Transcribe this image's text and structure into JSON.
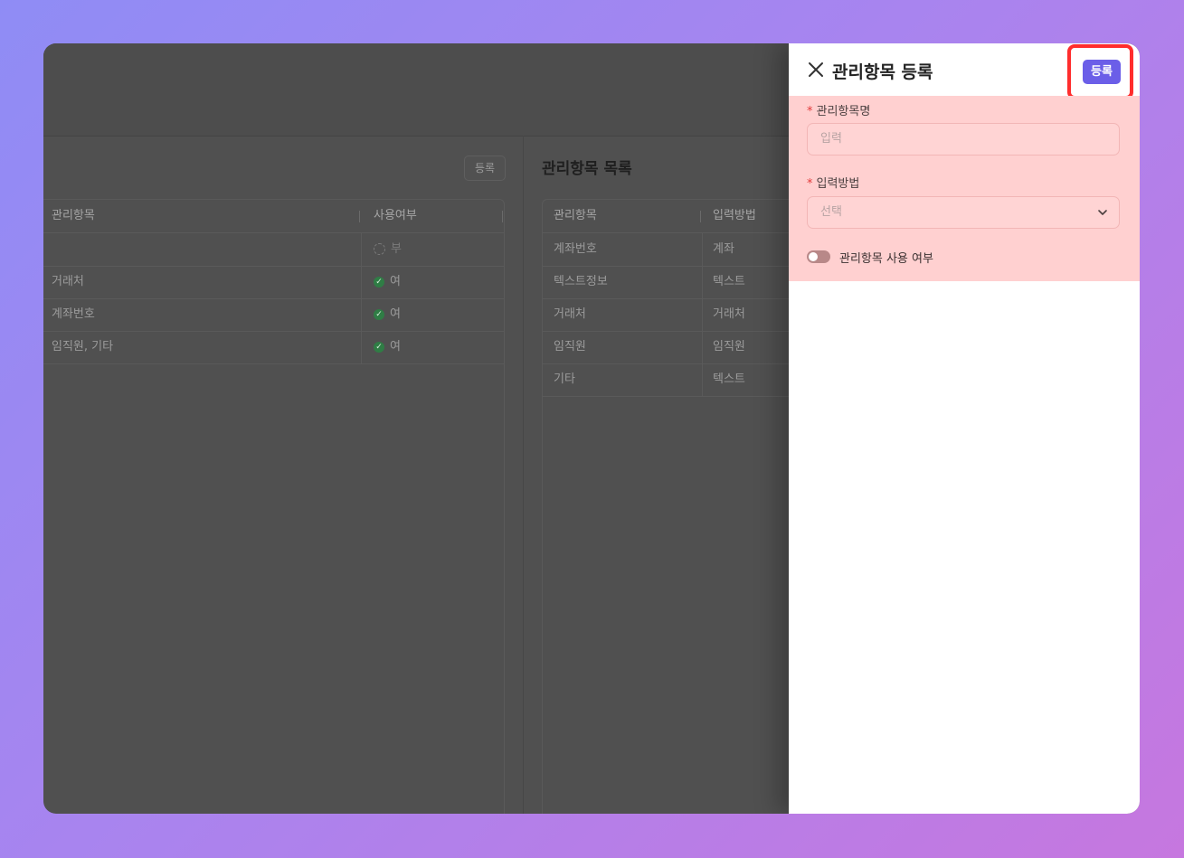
{
  "background_panel": {
    "register_button_label": "등록",
    "left_table": {
      "headers": [
        "관리항목",
        "사용여부"
      ],
      "rows": [
        {
          "name": "",
          "status": "부",
          "active": false
        },
        {
          "name": "거래처",
          "status": "여",
          "active": true
        },
        {
          "name": "계좌번호",
          "status": "여",
          "active": true
        },
        {
          "name": "임직원, 기타",
          "status": "여",
          "active": true
        }
      ]
    },
    "right_section_title": "관리항목 목록",
    "right_table": {
      "headers": [
        "관리항목",
        "입력방법"
      ],
      "rows": [
        {
          "name": "계좌번호",
          "method": "계좌"
        },
        {
          "name": "텍스트정보",
          "method": "텍스트"
        },
        {
          "name": "거래처",
          "method": "거래처"
        },
        {
          "name": "임직원",
          "method": "임직원"
        },
        {
          "name": "기타",
          "method": "텍스트"
        }
      ]
    }
  },
  "drawer": {
    "close_icon": "close-icon",
    "title": "관리항목 등록",
    "submit_label": "등록",
    "fields": {
      "name_label": "관리항목명",
      "name_placeholder": "입력",
      "method_label": "입력방법",
      "method_placeholder": "선택"
    },
    "toggle_label": "관리항목 사용 여부",
    "toggle_on": false,
    "colors": {
      "accent": "#6b5ee8",
      "highlight_border": "#ff2d2d",
      "form_highlight": "#ffd0d0"
    }
  }
}
